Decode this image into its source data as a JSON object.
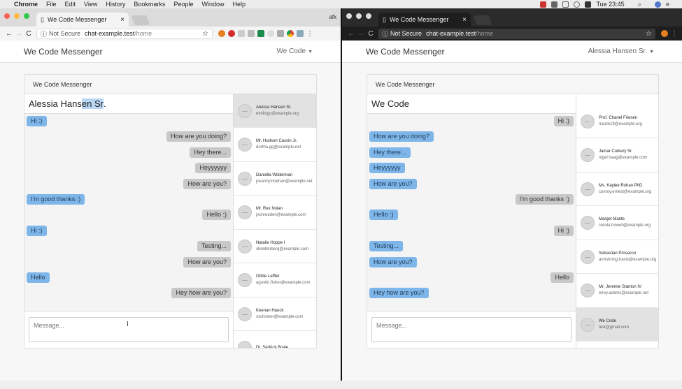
{
  "menubar": {
    "app": "Chrome",
    "items": [
      "File",
      "Edit",
      "View",
      "History",
      "Bookmarks",
      "People",
      "Window",
      "Help"
    ],
    "clock": "Tue 23:45"
  },
  "left": {
    "tab_title": "We Code Messenger",
    "tab_close": "×",
    "afk": "afk",
    "not_secure": "Not Secure",
    "url_host": "chat-example.test",
    "url_path": "/home",
    "brand": "We Code Messenger",
    "user_menu": "We Code",
    "panel_title": "We Code Messenger",
    "chat_title_pre": "Alessia Hans",
    "chat_title_hl": "en Sr",
    "chat_title_post": ".",
    "composer_placeholder": "Message...",
    "messages": [
      {
        "text": "Hi :)",
        "from": "me"
      },
      {
        "text": "How are you doing?",
        "from": "them"
      },
      {
        "text": "Hey there...",
        "from": "them"
      },
      {
        "text": "Heyyyyyy",
        "from": "them"
      },
      {
        "text": "How are you?",
        "from": "them"
      },
      {
        "text": "I'm good thanks :)",
        "from": "me"
      },
      {
        "text": "Hello :)",
        "from": "them"
      },
      {
        "text": "Hi :)",
        "from": "me"
      },
      {
        "text": "Testing...",
        "from": "them"
      },
      {
        "text": "How are you?",
        "from": "them"
      },
      {
        "text": "Hello",
        "from": "me"
      },
      {
        "text": "Hey how are you?",
        "from": "them"
      }
    ],
    "contacts": [
      {
        "name": "Alessia Hansen Sr.",
        "email": "emiliogc@example.org",
        "active": true
      },
      {
        "name": "Mr. Hudson Cassin Jr.",
        "email": "dortha.gg@example.net",
        "active": false
      },
      {
        "name": "Daniella Wilderman",
        "email": "jovanny.boehan@example.net",
        "active": false
      },
      {
        "name": "Mr. Rex Nolan",
        "email": "jvonrueden@example.com",
        "active": false
      },
      {
        "name": "Natalie Hoppe I",
        "email": "xbreitenberg@example.com",
        "active": false
      },
      {
        "name": "Ottilie Leffler",
        "email": "agustin.fisher@example.com",
        "active": false
      },
      {
        "name": "Keenan Hauck",
        "email": "xschinner@example.com",
        "active": false
      },
      {
        "name": "Dr. Sedrick Boyle",
        "email": "",
        "active": false
      }
    ]
  },
  "right": {
    "tab_title": "We Code Messenger",
    "tab_close": "×",
    "not_secure": "Not Secure",
    "url_host": "chat-example.test",
    "url_path": "/home",
    "brand": "We Code Messenger",
    "user_menu": "Alessia Hansen Sr.",
    "panel_title": "We Code Messenger",
    "chat_title": "We Code",
    "composer_placeholder": "Message...",
    "messages": [
      {
        "text": "Hi :)",
        "from": "them"
      },
      {
        "text": "How are you doing?",
        "from": "me"
      },
      {
        "text": "Hey there...",
        "from": "me"
      },
      {
        "text": "Heyyyyyy",
        "from": "me"
      },
      {
        "text": "How are you?",
        "from": "me"
      },
      {
        "text": "I'm good thanks :)",
        "from": "them"
      },
      {
        "text": "Hello :)",
        "from": "me"
      },
      {
        "text": "Hi :)",
        "from": "them"
      },
      {
        "text": "Testing...",
        "from": "me"
      },
      {
        "text": "How are you?",
        "from": "me"
      },
      {
        "text": "Hello",
        "from": "them"
      },
      {
        "text": "Hey how are you?",
        "from": "me"
      }
    ],
    "contacts": [
      {
        "name": "Prof. Chanel Friesen",
        "email": "mazie19@example.org",
        "active": false
      },
      {
        "name": "Jamar Corkery Sr.",
        "email": "nigel.haag@example.com",
        "active": false
      },
      {
        "name": "Ms. Kaylee Rohan PhD",
        "email": "conroy.ernest@example.org",
        "active": false
      },
      {
        "name": "Marget Mante",
        "email": "creola.howell@example.org",
        "active": false
      },
      {
        "name": "Sebastian Prosacco",
        "email": "armstrong.travis@example.org",
        "active": false
      },
      {
        "name": "Mr. Jeremie Stanton IV",
        "email": "elroy.adams@example.net",
        "active": false
      },
      {
        "name": "We Code",
        "email": "test@gmail.com",
        "active": true
      }
    ]
  },
  "colors": {
    "my_bubble": "#7fb6e9",
    "their_bubble": "#c8c8c8",
    "active_contact": "#e2e2e2",
    "dark_chrome": "#1e1e1e"
  }
}
